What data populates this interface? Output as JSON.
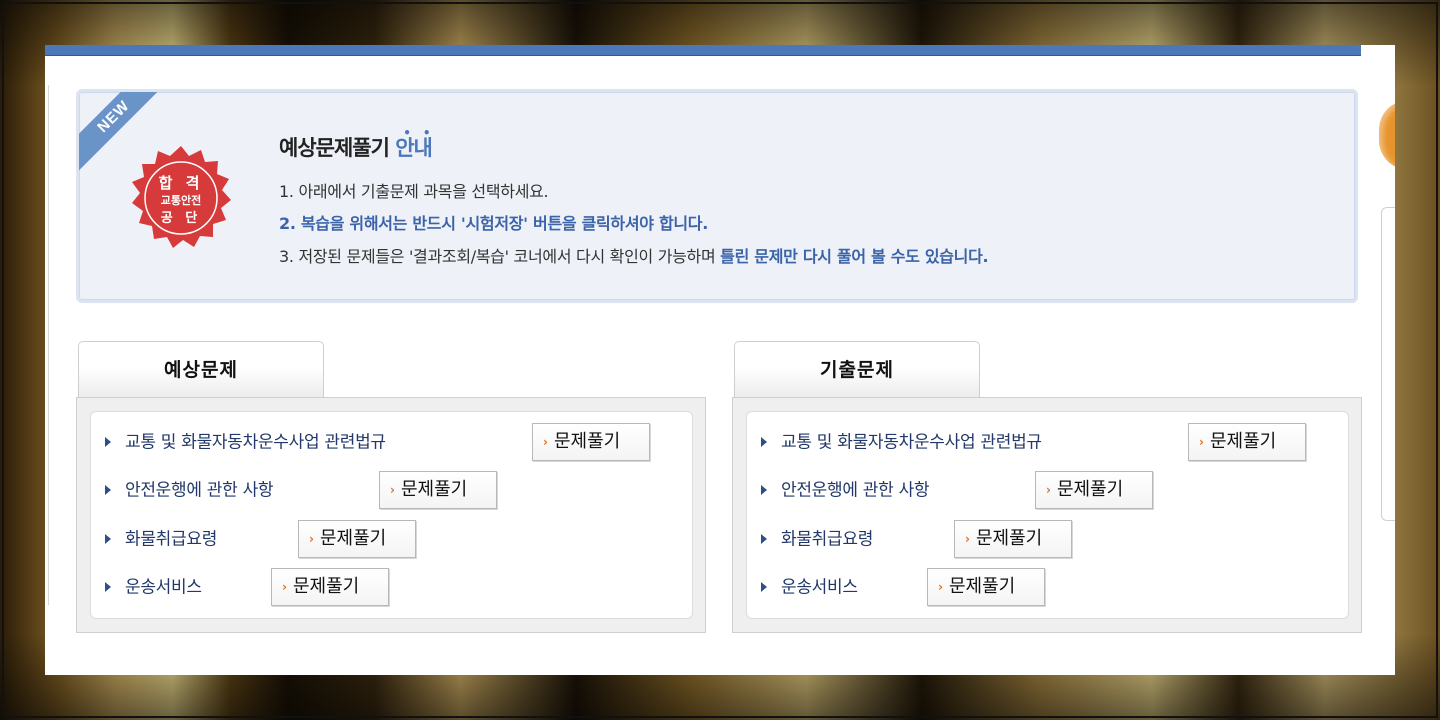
{
  "badge": {
    "new_label": "NEW",
    "seal_line1": "합 격",
    "seal_line2": "교통안전",
    "seal_line3": "공 단"
  },
  "notice": {
    "title_main": "예상문제풀기",
    "title_accent": "안내",
    "line1": "1. 아래에서 기출문제 과목을 선택하세요.",
    "line2": "2. 복습을 위해서는 반드시 '시험저장' 버튼을 클릭하셔야 합니다.",
    "line3_plain": "3. 저장된 문제들은 '결과조회/복습' 코너에서 다시 확인이 가능하며 ",
    "line3_highlight": "틀린 문제만 다시 풀어 볼 수도 있습니다."
  },
  "panels": [
    {
      "tab": "예상문제",
      "items": [
        {
          "label": "교통 및 화물자동차운수사업 관련법규",
          "button": "문제풀기"
        },
        {
          "label": "안전운행에 관한 사항",
          "button": "문제풀기"
        },
        {
          "label": "화물취급요령",
          "button": "문제풀기"
        },
        {
          "label": "운송서비스",
          "button": "문제풀기"
        }
      ]
    },
    {
      "tab": "기출문제",
      "items": [
        {
          "label": "교통 및 화물자동차운수사업 관련법규",
          "button": "문제풀기"
        },
        {
          "label": "안전운행에 관한 사항",
          "button": "문제풀기"
        },
        {
          "label": "화물취급요령",
          "button": "문제풀기"
        },
        {
          "label": "운송서비스",
          "button": "문제풀기"
        }
      ]
    }
  ],
  "colors": {
    "accent": "#4a78b8",
    "seal": "#d63a3a",
    "link": "#22386a",
    "chevron": "#e07020"
  }
}
